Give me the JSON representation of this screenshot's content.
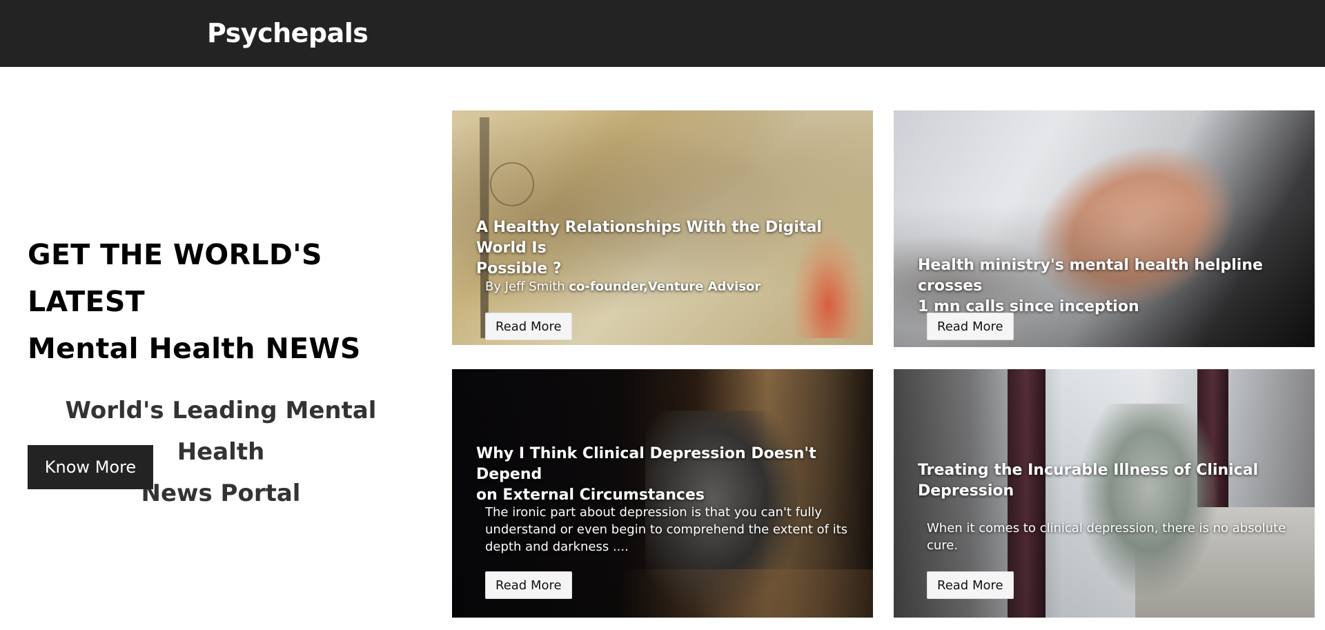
{
  "header": {
    "brand": "Psychepals"
  },
  "hero": {
    "title_line1": "GET THE WORLD'S LATEST",
    "title_line2": "Mental Health NEWS",
    "subtitle_line1": "World's Leading Mental Health",
    "subtitle_line2": "News Portal",
    "cta_label": "Know More"
  },
  "cards": [
    {
      "title_line1": "A Healthy Relationships With the Digital World Is",
      "title_line2": "Possible ?",
      "author_prefix": "By Jeff Smith",
      "author_role": "co-founder,Venture Advisor",
      "button": "Read More"
    },
    {
      "title_line1": "Health ministry's mental health helpline crosses",
      "title_line2": "1 mn calls since inception",
      "button": "Read More"
    },
    {
      "title_line1": "Why I Think Clinical Depression Doesn't Depend",
      "title_line2": "on External Circumstances",
      "excerpt_line1": "The ironic part about depression is that you can't fully",
      "excerpt_line2": "understand or even begin to comprehend the extent of its",
      "excerpt_line3": "depth and darkness ....",
      "button": "Read More"
    },
    {
      "title_line1": "Treating the Incurable Illness of Clinical",
      "title_line2": "Depression",
      "excerpt_line1": "When it comes to clinical depression, there is no absolute",
      "excerpt_line2": "cure.",
      "button": "Read More"
    }
  ]
}
